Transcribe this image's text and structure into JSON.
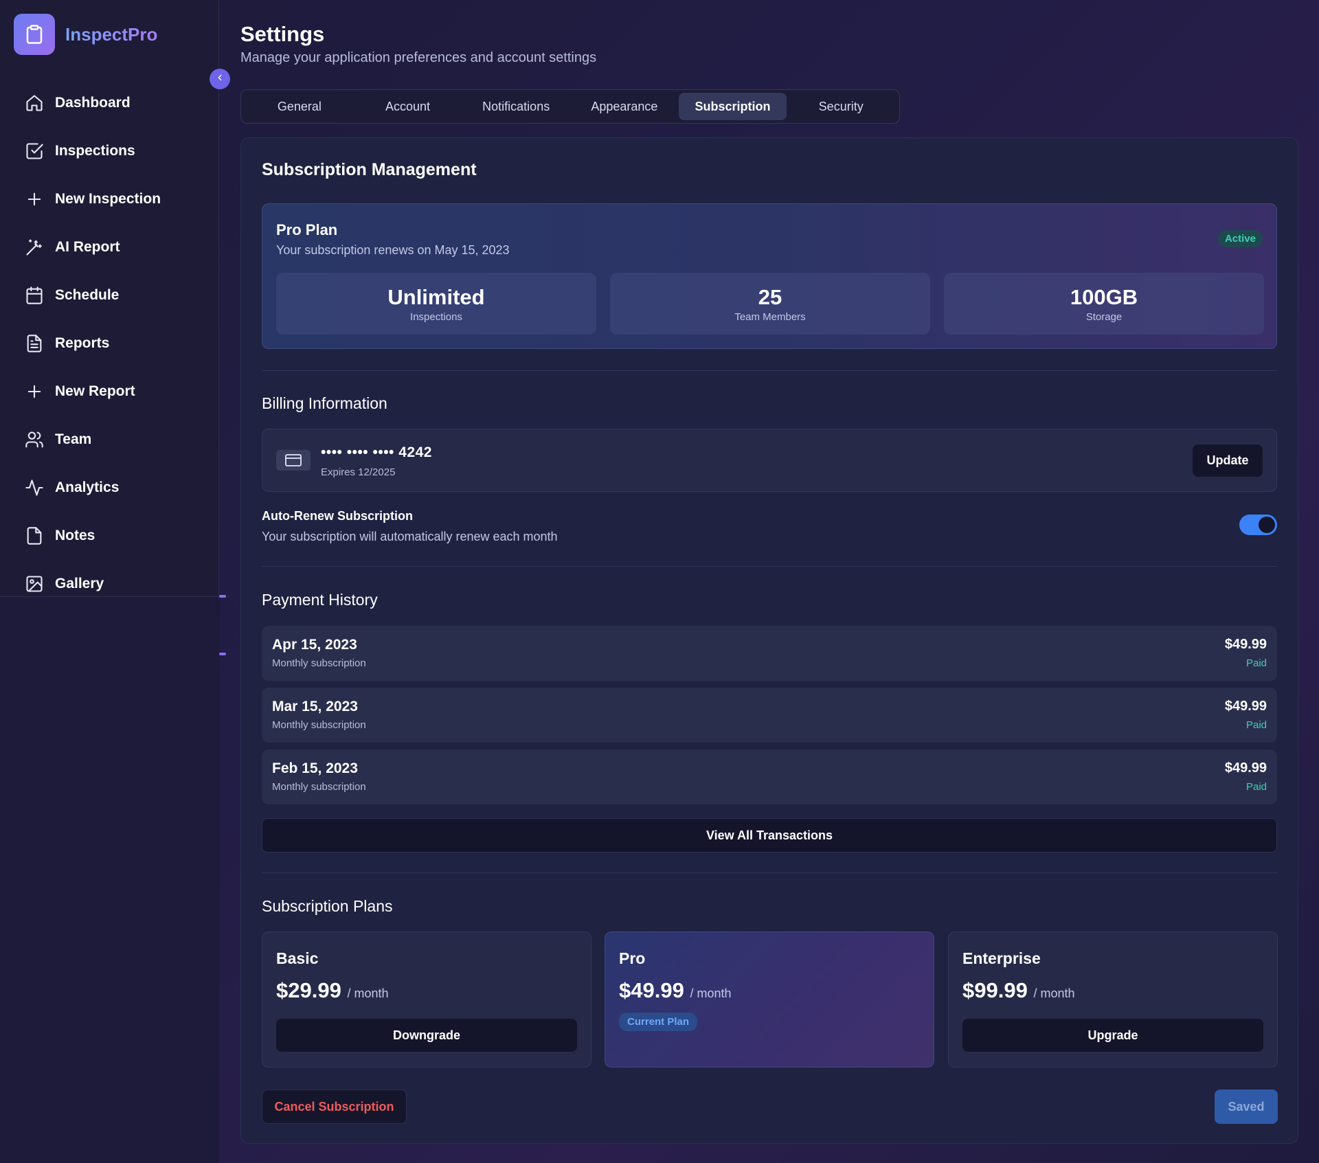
{
  "app": {
    "name": "InspectPro"
  },
  "sidebar": {
    "items": [
      {
        "label": "Dashboard",
        "icon": "home-icon"
      },
      {
        "label": "Inspections",
        "icon": "check-square-icon"
      },
      {
        "label": "New Inspection",
        "icon": "plus-icon"
      },
      {
        "label": "AI Report",
        "icon": "magic-wand-icon"
      },
      {
        "label": "Schedule",
        "icon": "calendar-icon"
      },
      {
        "label": "Reports",
        "icon": "file-text-icon"
      },
      {
        "label": "New Report",
        "icon": "plus-icon"
      },
      {
        "label": "Team",
        "icon": "users-icon"
      },
      {
        "label": "Analytics",
        "icon": "activity-icon"
      },
      {
        "label": "Notes",
        "icon": "file-icon"
      },
      {
        "label": "Gallery",
        "icon": "image-icon"
      }
    ]
  },
  "header": {
    "title": "Settings",
    "subtitle": "Manage your application preferences and account settings"
  },
  "tabs": [
    {
      "label": "General"
    },
    {
      "label": "Account"
    },
    {
      "label": "Notifications"
    },
    {
      "label": "Appearance"
    },
    {
      "label": "Subscription",
      "active": true
    },
    {
      "label": "Security"
    }
  ],
  "subscription": {
    "title": "Subscription Management",
    "plan": {
      "name": "Pro Plan",
      "renewal": "Your subscription renews on May 15, 2023",
      "status": "Active",
      "stats": [
        {
          "value": "Unlimited",
          "label": "Inspections"
        },
        {
          "value": "25",
          "label": "Team Members"
        },
        {
          "value": "100GB",
          "label": "Storage"
        }
      ]
    }
  },
  "billing": {
    "title": "Billing Information",
    "card_number": "•••• •••• •••• 4242",
    "card_expiry": "Expires 12/2025",
    "update_label": "Update",
    "auto_renew": {
      "title": "Auto-Renew Subscription",
      "description": "Your subscription will automatically renew each month",
      "enabled": true
    }
  },
  "payment_history": {
    "title": "Payment History",
    "rows": [
      {
        "date": "Apr 15, 2023",
        "description": "Monthly subscription",
        "amount": "$49.99",
        "status": "Paid"
      },
      {
        "date": "Mar 15, 2023",
        "description": "Monthly subscription",
        "amount": "$49.99",
        "status": "Paid"
      },
      {
        "date": "Feb 15, 2023",
        "description": "Monthly subscription",
        "amount": "$49.99",
        "status": "Paid"
      }
    ],
    "view_all_label": "View All Transactions"
  },
  "plans": {
    "title": "Subscription Plans",
    "items": [
      {
        "name": "Basic",
        "price": "$29.99",
        "period": "/ month",
        "action": "Downgrade"
      },
      {
        "name": "Pro",
        "price": "$49.99",
        "period": "/ month",
        "badge": "Current Plan"
      },
      {
        "name": "Enterprise",
        "price": "$99.99",
        "period": "/ month",
        "action": "Upgrade"
      }
    ]
  },
  "footer": {
    "cancel_label": "Cancel Subscription",
    "save_label": "Saved"
  },
  "colors": {
    "accent": "#3b82f6",
    "success": "#3ad1b2",
    "danger": "#f05b5b",
    "brand_gradient_start": "#7aa2f7",
    "brand_gradient_end": "#a57cf5"
  }
}
